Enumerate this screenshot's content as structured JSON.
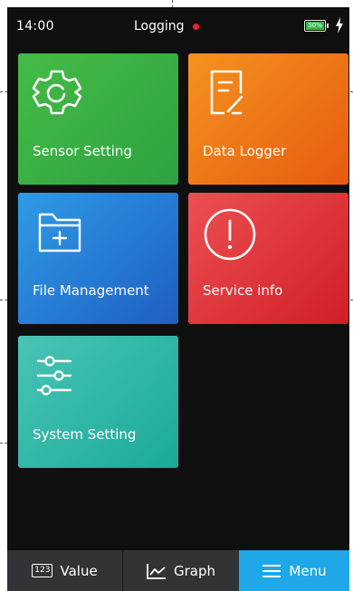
{
  "status_bar": {
    "time": "14:00",
    "logging_label": "Logging",
    "battery_percent": "50%",
    "recording_color": "#e8252d",
    "charging_icon": "lightning-icon"
  },
  "tiles": [
    {
      "label": "Sensor Setting",
      "icon": "gear-icon",
      "color": "#3bb044"
    },
    {
      "label": "Data Logger",
      "icon": "document-edit-icon",
      "color": "#ee7318"
    },
    {
      "label": "File Management",
      "icon": "folder-plus-icon",
      "color": "#2a86d8"
    },
    {
      "label": "Service info",
      "icon": "info-circle-icon",
      "color": "#e13a3e"
    },
    {
      "label": "System Setting",
      "icon": "sliders-icon",
      "color": "#2db7a7"
    }
  ],
  "bottom_nav": {
    "value_label": "Value",
    "value_icon_text": "123",
    "graph_label": "Graph",
    "menu_label": "Menu",
    "active_color": "#1fa7e8"
  }
}
